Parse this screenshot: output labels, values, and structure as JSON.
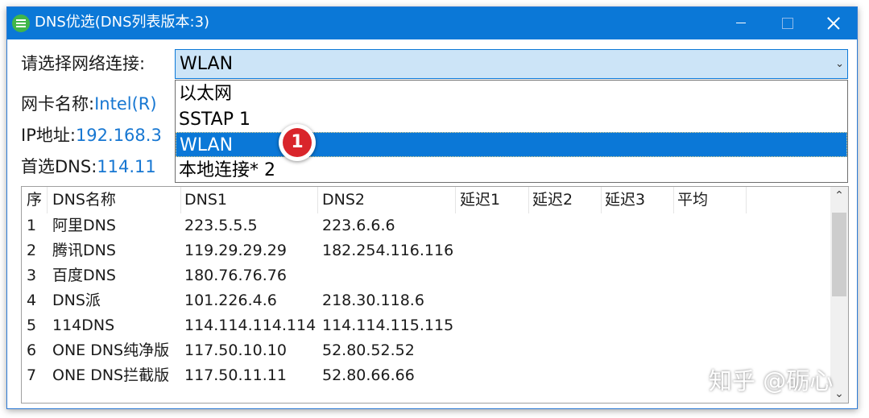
{
  "window": {
    "title": "DNS优选(DNS列表版本:3)"
  },
  "form": {
    "connection_label": "请选择网络连接:",
    "connection_selected": "WLAN",
    "adapter_label": "网卡名称:",
    "adapter_value": "Intel(R)",
    "ip_label": "IP地址:",
    "ip_value": "192.168.3",
    "dns_label": "首选DNS:",
    "dns_value": "114.11"
  },
  "dropdown": {
    "options": [
      "以太网",
      "SSTAP 1",
      "WLAN",
      "本地连接* 2"
    ],
    "selected_index": 2
  },
  "marker": {
    "number": "1"
  },
  "table": {
    "columns": [
      "序",
      "DNS名称",
      "DNS1",
      "DNS2",
      "延迟1",
      "延迟2",
      "延迟3",
      "平均"
    ],
    "rows": [
      [
        "1",
        "阿里DNS",
        "223.5.5.5",
        "223.6.6.6"
      ],
      [
        "2",
        "腾讯DNS",
        "119.29.29.29",
        "182.254.116.116"
      ],
      [
        "3",
        "百度DNS",
        "180.76.76.76",
        ""
      ],
      [
        "4",
        "DNS派",
        "101.226.4.6",
        "218.30.118.6"
      ],
      [
        "5",
        "114DNS",
        "114.114.114.114",
        "114.114.115.115"
      ],
      [
        "6",
        "ONE DNS纯净版",
        "117.50.10.10",
        "52.80.52.52"
      ],
      [
        "7",
        "ONE DNS拦截版",
        "117.50.11.11",
        "52.80.66.66"
      ]
    ]
  },
  "watermark": "知乎 @砺心",
  "colors": {
    "accent": "#0b78d7",
    "value_text": "#1777d2",
    "marker": "#d9252b"
  }
}
